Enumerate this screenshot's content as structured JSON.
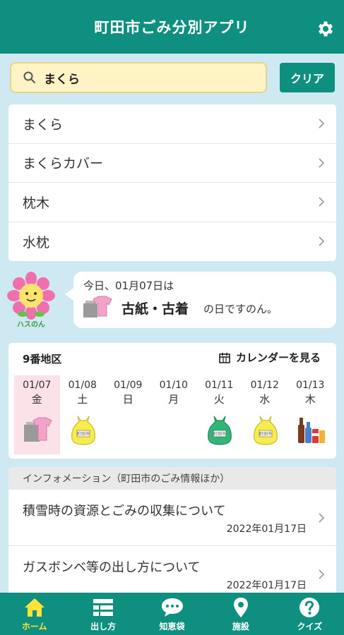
{
  "header": {
    "title": "町田市ごみ分別アプリ",
    "settings_icon": "gear-icon"
  },
  "search": {
    "value": "まくら",
    "placeholder": "",
    "clear_label": "クリア"
  },
  "results": [
    {
      "label": "まくら"
    },
    {
      "label": "まくらカバー"
    },
    {
      "label": "枕木"
    },
    {
      "label": "水枕"
    }
  ],
  "today": {
    "mascot_text": "ハスのん",
    "line1": "今日、01月07日は",
    "type": "古紙・古着",
    "suffix": "の日ですのん。"
  },
  "calendar": {
    "area": "9番地区",
    "link_label": "カレンダーを見る",
    "days": [
      {
        "date": "01/07",
        "weekday": "金",
        "icon": "paper-clothes-icon",
        "today": true
      },
      {
        "date": "01/08",
        "weekday": "土",
        "icon": "yellow-bag-icon"
      },
      {
        "date": "01/09",
        "weekday": "日",
        "icon": ""
      },
      {
        "date": "01/10",
        "weekday": "月",
        "icon": ""
      },
      {
        "date": "01/11",
        "weekday": "火",
        "icon": "green-bag-icon"
      },
      {
        "date": "01/12",
        "weekday": "水",
        "icon": "yellow-bag-icon"
      },
      {
        "date": "01/13",
        "weekday": "木",
        "icon": "bottles-cans-icon"
      }
    ],
    "bag_label": "町田市"
  },
  "info": {
    "header": "インフォメーション（町田市のごみ情報ほか）",
    "items": [
      {
        "title": "積雪時の資源とごみの収集について",
        "date": "2022年01月17日"
      },
      {
        "title": "ガスボンベ等の出し方について",
        "date": "2022年01月17日"
      }
    ]
  },
  "nav": [
    {
      "label": "ホーム",
      "icon": "home-icon",
      "active": true
    },
    {
      "label": "出し方",
      "icon": "list-icon"
    },
    {
      "label": "知恵袋",
      "icon": "chat-icon"
    },
    {
      "label": "施設",
      "icon": "map-pin-icon"
    },
    {
      "label": "クイズ",
      "icon": "question-icon"
    }
  ],
  "colors": {
    "primary": "#0e8f7f",
    "background": "#cfe9f2",
    "search_bg": "#fdf3c4",
    "active_nav": "#ffe23a",
    "today_bg": "#fbe2e8"
  }
}
